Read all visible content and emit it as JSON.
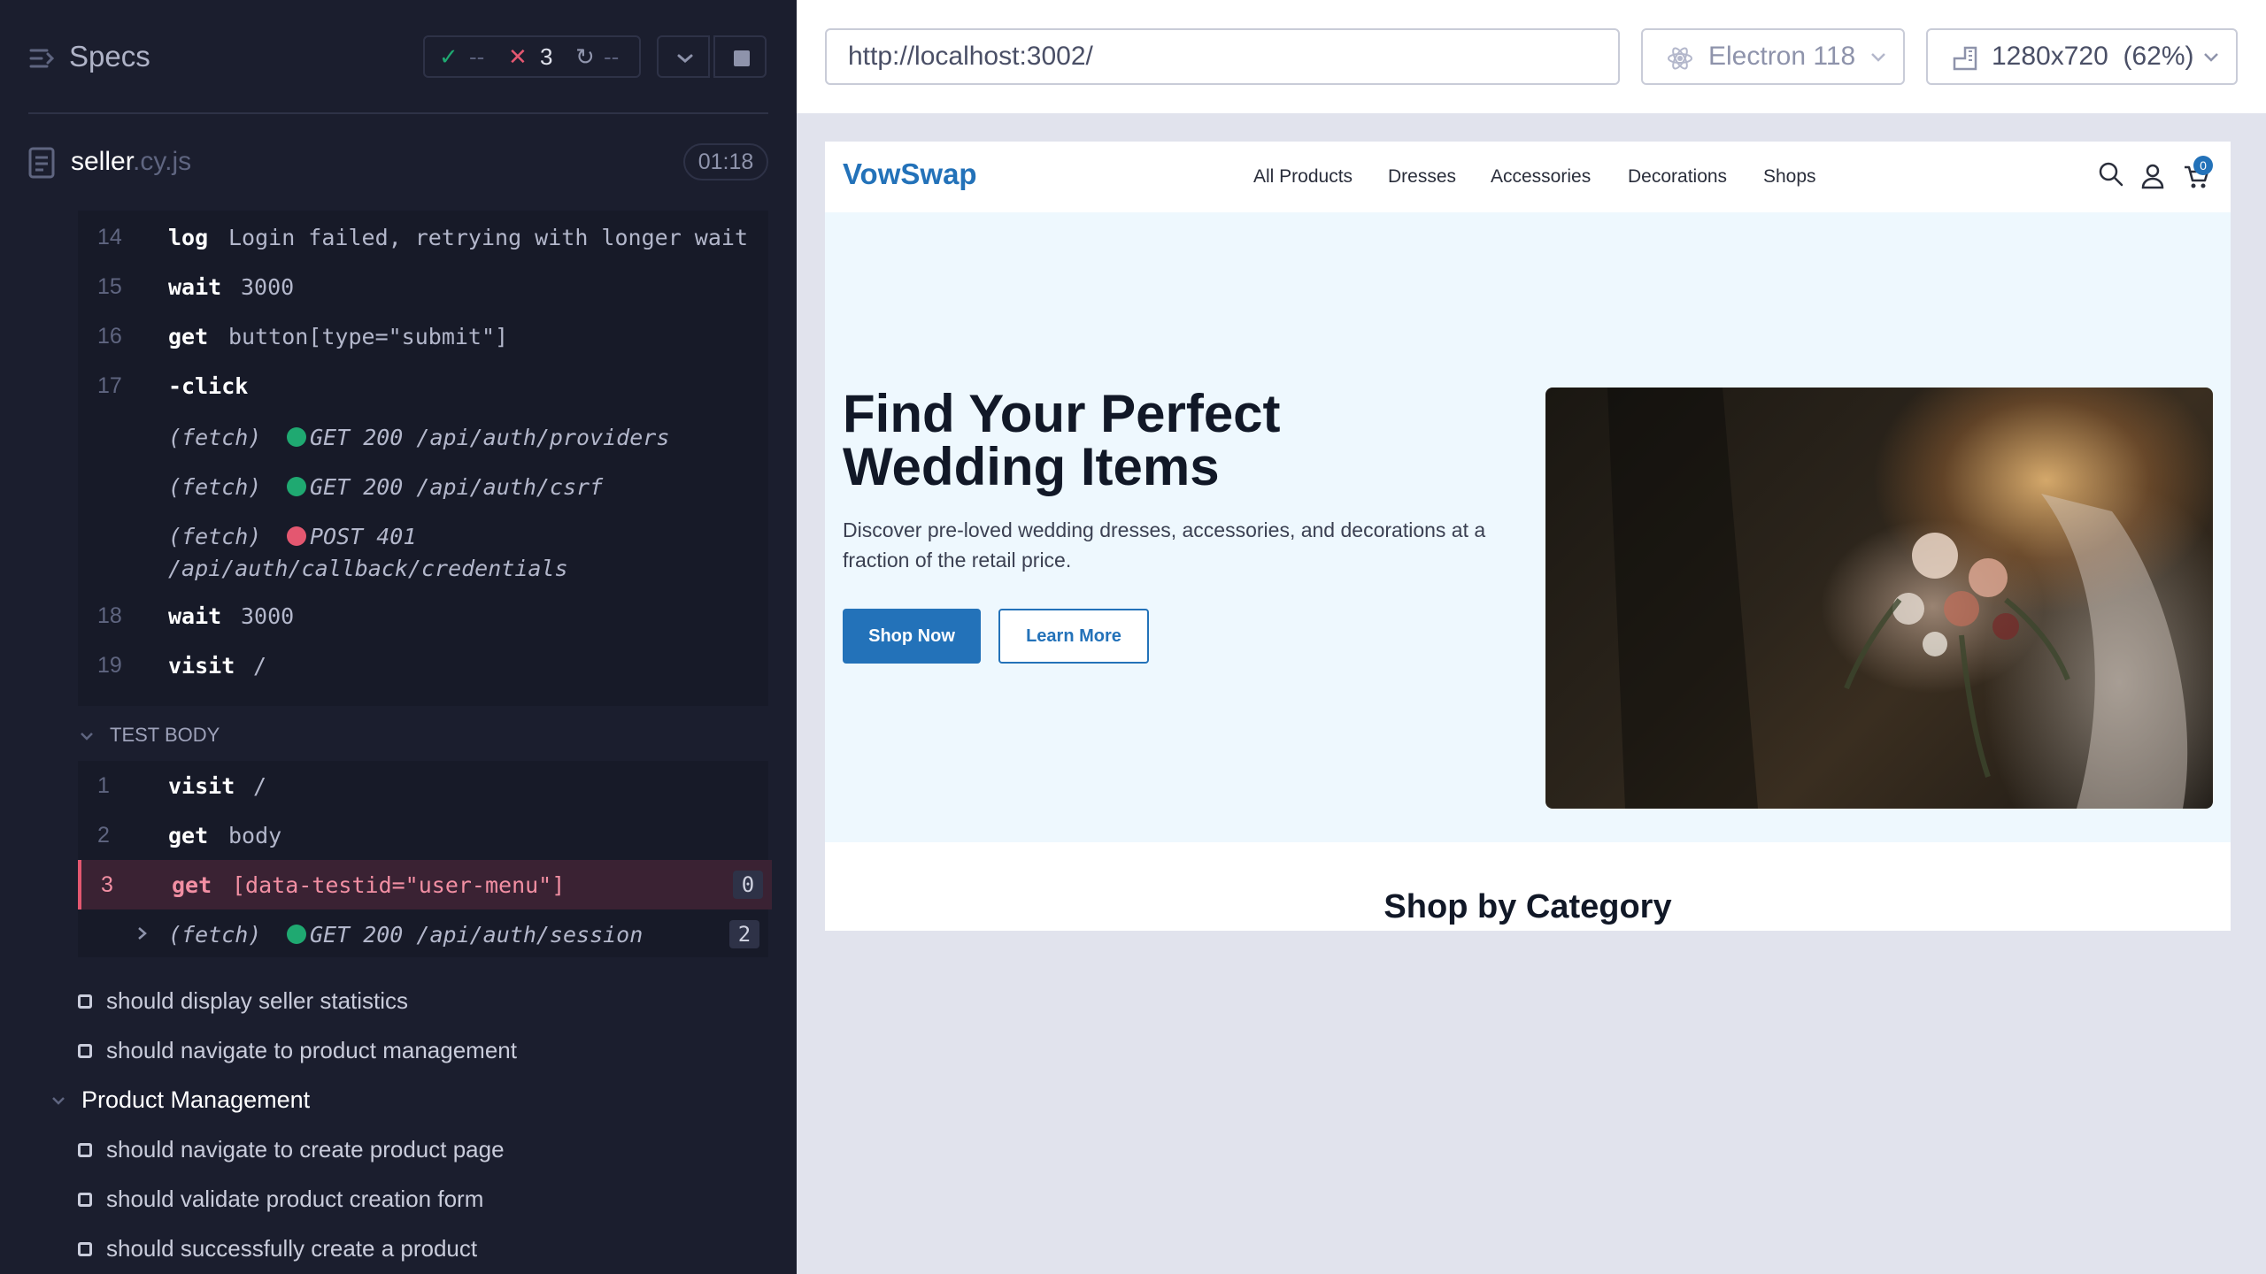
{
  "reporter": {
    "title": "Specs",
    "stats": {
      "passed": "--",
      "failed": "3",
      "pending": "--"
    },
    "file": {
      "name": "seller",
      "ext": ".cy.js",
      "duration": "01:18"
    },
    "hooks": [
      {
        "num": "14",
        "name": "log",
        "msg": "Login failed, retrying with longer wait"
      },
      {
        "num": "15",
        "name": "wait",
        "msg": "3000"
      },
      {
        "num": "16",
        "name": "get",
        "msg": "button[type=\"submit\"]"
      },
      {
        "num": "17",
        "name": "-click",
        "msg": ""
      },
      {
        "num": "",
        "name": "(fetch)",
        "msg": "GET 200 /api/auth/providers",
        "status": "green"
      },
      {
        "num": "",
        "name": "(fetch)",
        "msg": "GET 200 /api/auth/csrf",
        "status": "green"
      },
      {
        "num": "",
        "name": "(fetch)",
        "msg": "POST 401",
        "msg2": "/api/auth/callback/credentials",
        "status": "red"
      },
      {
        "num": "18",
        "name": "wait",
        "msg": "3000"
      },
      {
        "num": "19",
        "name": "visit",
        "msg": "/"
      }
    ],
    "test_body_label": "TEST BODY",
    "body": [
      {
        "num": "1",
        "name": "visit",
        "msg": "/"
      },
      {
        "num": "2",
        "name": "get",
        "msg": "body"
      },
      {
        "num": "3",
        "name": "get",
        "msg": "[data-testid=\"user-menu\"]",
        "badge": "0"
      },
      {
        "num": "",
        "name": "(fetch)",
        "msg": "GET 200 /api/auth/session",
        "badge": "2"
      }
    ],
    "tests_a": [
      "should display seller statistics",
      "should navigate to product management"
    ],
    "suite": "Product Management",
    "tests_b": [
      "should navigate to create product page",
      "should validate product creation form",
      "should successfully create a product"
    ]
  },
  "aut": {
    "url": "http://localhost:3002/",
    "browser": "Electron 118",
    "viewport": "1280x720  (62%)",
    "site": {
      "logo": "VowSwap",
      "nav": [
        "All Products",
        "Dresses",
        "Accessories",
        "Decorations",
        "Shops"
      ],
      "cart_count": "0",
      "hero_title": "Find Your Perfect Wedding Items",
      "hero_sub": "Discover pre-loved wedding dresses, accessories, and decorations at a fraction of the retail price.",
      "shop_now": "Shop Now",
      "learn_more": "Learn More",
      "section_title": "Shop by Category"
    }
  }
}
